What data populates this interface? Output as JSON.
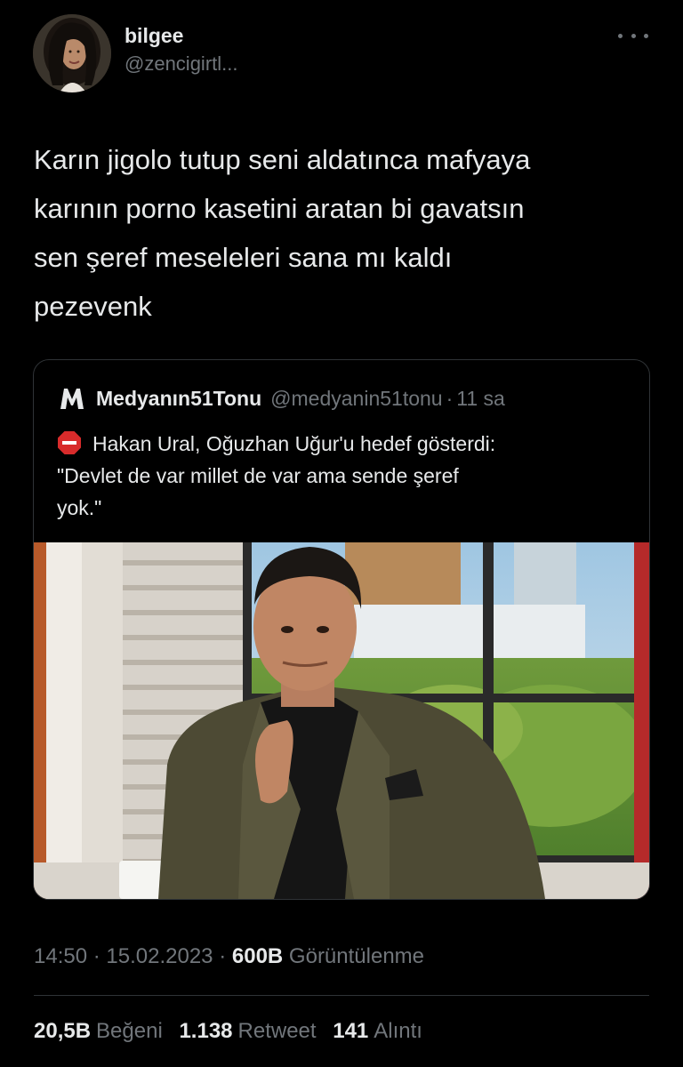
{
  "author": {
    "display_name": "bilgee",
    "handle": "@zencigirtl...",
    "avatar_icon": "profile-photo"
  },
  "tweet": {
    "lines": [
      "Karın jigolo tutup seni aldatınca mafyaya",
      "karının porno kasetini aratan bi gavatsın",
      "sen şeref meseleleri sana mı kaldı",
      "pezevenk"
    ]
  },
  "quote": {
    "logo_icon": "medya-m-logo",
    "name": "Medyanın51Tonu",
    "handle": "@medyanin51tonu",
    "separator": "·",
    "time": "11 sa",
    "stop_icon": "stop-sign-icon",
    "lines": [
      "Hakan Ural, Oğuzhan Uğur'u hedef gösterdi:",
      "\"Devlet de var millet de var ama sende şeref",
      "yok.\""
    ]
  },
  "meta": {
    "time": "14:50",
    "separator": "·",
    "date": "15.02.2023",
    "views_count": "600B",
    "views_label": "Görüntülenme"
  },
  "stats": {
    "likes_count": "20,5B",
    "likes_label": "Beğeni",
    "retweets_count": "1.138",
    "retweets_label": "Retweet",
    "quotes_count": "141",
    "quotes_label": "Alıntı"
  },
  "colors": {
    "background": "#000000",
    "text_primary": "#e7e9ea",
    "text_secondary": "#71767b",
    "border": "#2f3336",
    "stop_red": "#d82b2b"
  }
}
